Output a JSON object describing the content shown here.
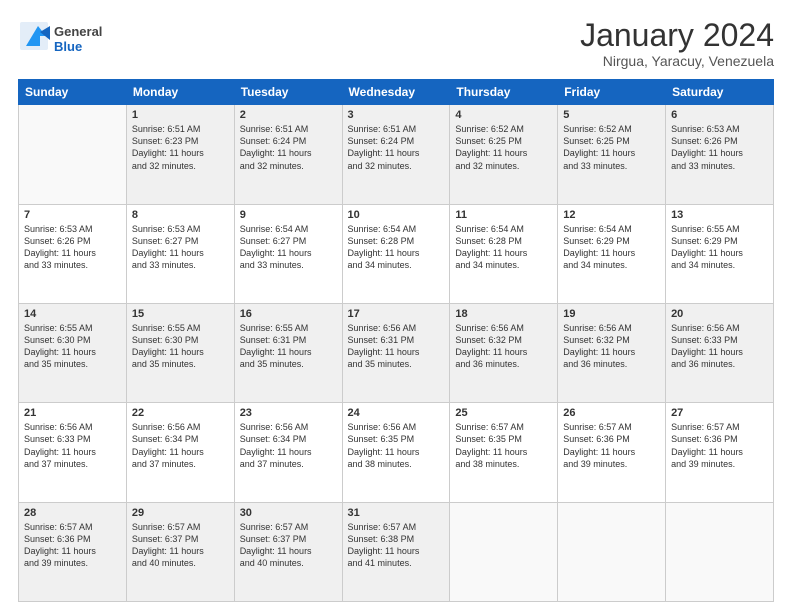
{
  "logo": {
    "general": "General",
    "blue": "Blue"
  },
  "title": "January 2024",
  "subtitle": "Nirgua, Yaracuy, Venezuela",
  "headers": [
    "Sunday",
    "Monday",
    "Tuesday",
    "Wednesday",
    "Thursday",
    "Friday",
    "Saturday"
  ],
  "weeks": [
    [
      {
        "day": "",
        "sunrise": "",
        "sunset": "",
        "daylight": ""
      },
      {
        "day": "1",
        "sunrise": "6:51 AM",
        "sunset": "6:23 PM",
        "daylight": "11 hours and 32 minutes."
      },
      {
        "day": "2",
        "sunrise": "6:51 AM",
        "sunset": "6:24 PM",
        "daylight": "11 hours and 32 minutes."
      },
      {
        "day": "3",
        "sunrise": "6:51 AM",
        "sunset": "6:24 PM",
        "daylight": "11 hours and 32 minutes."
      },
      {
        "day": "4",
        "sunrise": "6:52 AM",
        "sunset": "6:25 PM",
        "daylight": "11 hours and 32 minutes."
      },
      {
        "day": "5",
        "sunrise": "6:52 AM",
        "sunset": "6:25 PM",
        "daylight": "11 hours and 33 minutes."
      },
      {
        "day": "6",
        "sunrise": "6:53 AM",
        "sunset": "6:26 PM",
        "daylight": "11 hours and 33 minutes."
      }
    ],
    [
      {
        "day": "7",
        "sunrise": "6:53 AM",
        "sunset": "6:26 PM",
        "daylight": "11 hours and 33 minutes."
      },
      {
        "day": "8",
        "sunrise": "6:53 AM",
        "sunset": "6:27 PM",
        "daylight": "11 hours and 33 minutes."
      },
      {
        "day": "9",
        "sunrise": "6:54 AM",
        "sunset": "6:27 PM",
        "daylight": "11 hours and 33 minutes."
      },
      {
        "day": "10",
        "sunrise": "6:54 AM",
        "sunset": "6:28 PM",
        "daylight": "11 hours and 34 minutes."
      },
      {
        "day": "11",
        "sunrise": "6:54 AM",
        "sunset": "6:28 PM",
        "daylight": "11 hours and 34 minutes."
      },
      {
        "day": "12",
        "sunrise": "6:54 AM",
        "sunset": "6:29 PM",
        "daylight": "11 hours and 34 minutes."
      },
      {
        "day": "13",
        "sunrise": "6:55 AM",
        "sunset": "6:29 PM",
        "daylight": "11 hours and 34 minutes."
      }
    ],
    [
      {
        "day": "14",
        "sunrise": "6:55 AM",
        "sunset": "6:30 PM",
        "daylight": "11 hours and 35 minutes."
      },
      {
        "day": "15",
        "sunrise": "6:55 AM",
        "sunset": "6:30 PM",
        "daylight": "11 hours and 35 minutes."
      },
      {
        "day": "16",
        "sunrise": "6:55 AM",
        "sunset": "6:31 PM",
        "daylight": "11 hours and 35 minutes."
      },
      {
        "day": "17",
        "sunrise": "6:56 AM",
        "sunset": "6:31 PM",
        "daylight": "11 hours and 35 minutes."
      },
      {
        "day": "18",
        "sunrise": "6:56 AM",
        "sunset": "6:32 PM",
        "daylight": "11 hours and 36 minutes."
      },
      {
        "day": "19",
        "sunrise": "6:56 AM",
        "sunset": "6:32 PM",
        "daylight": "11 hours and 36 minutes."
      },
      {
        "day": "20",
        "sunrise": "6:56 AM",
        "sunset": "6:33 PM",
        "daylight": "11 hours and 36 minutes."
      }
    ],
    [
      {
        "day": "21",
        "sunrise": "6:56 AM",
        "sunset": "6:33 PM",
        "daylight": "11 hours and 37 minutes."
      },
      {
        "day": "22",
        "sunrise": "6:56 AM",
        "sunset": "6:34 PM",
        "daylight": "11 hours and 37 minutes."
      },
      {
        "day": "23",
        "sunrise": "6:56 AM",
        "sunset": "6:34 PM",
        "daylight": "11 hours and 37 minutes."
      },
      {
        "day": "24",
        "sunrise": "6:56 AM",
        "sunset": "6:35 PM",
        "daylight": "11 hours and 38 minutes."
      },
      {
        "day": "25",
        "sunrise": "6:57 AM",
        "sunset": "6:35 PM",
        "daylight": "11 hours and 38 minutes."
      },
      {
        "day": "26",
        "sunrise": "6:57 AM",
        "sunset": "6:36 PM",
        "daylight": "11 hours and 39 minutes."
      },
      {
        "day": "27",
        "sunrise": "6:57 AM",
        "sunset": "6:36 PM",
        "daylight": "11 hours and 39 minutes."
      }
    ],
    [
      {
        "day": "28",
        "sunrise": "6:57 AM",
        "sunset": "6:36 PM",
        "daylight": "11 hours and 39 minutes."
      },
      {
        "day": "29",
        "sunrise": "6:57 AM",
        "sunset": "6:37 PM",
        "daylight": "11 hours and 40 minutes."
      },
      {
        "day": "30",
        "sunrise": "6:57 AM",
        "sunset": "6:37 PM",
        "daylight": "11 hours and 40 minutes."
      },
      {
        "day": "31",
        "sunrise": "6:57 AM",
        "sunset": "6:38 PM",
        "daylight": "11 hours and 41 minutes."
      },
      {
        "day": "",
        "sunrise": "",
        "sunset": "",
        "daylight": ""
      },
      {
        "day": "",
        "sunrise": "",
        "sunset": "",
        "daylight": ""
      },
      {
        "day": "",
        "sunrise": "",
        "sunset": "",
        "daylight": ""
      }
    ]
  ],
  "row_shaded": [
    true,
    false,
    true,
    false,
    true
  ]
}
